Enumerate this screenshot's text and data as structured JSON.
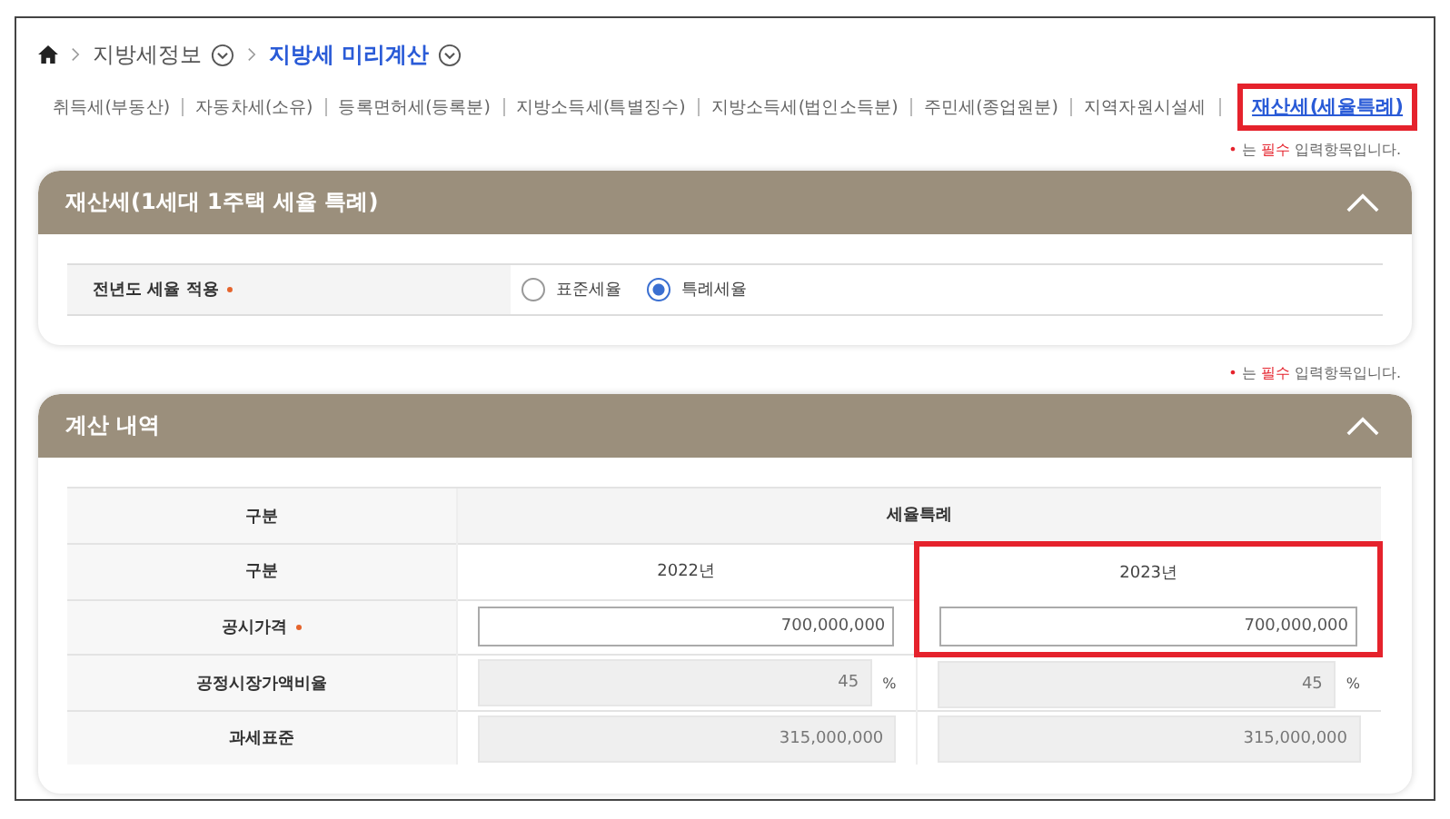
{
  "breadcrumb": [
    {
      "label": "지방세정보",
      "current": false
    },
    {
      "label": "지방세 미리계산",
      "current": true
    }
  ],
  "tabs": [
    {
      "label": "취득세(부동산)",
      "selected": false,
      "highlighted": false
    },
    {
      "label": "자동차세(소유)",
      "selected": false,
      "highlighted": false
    },
    {
      "label": "등록면허세(등록분)",
      "selected": false,
      "highlighted": false
    },
    {
      "label": "지방소득세(특별징수)",
      "selected": false,
      "highlighted": false
    },
    {
      "label": "지방소득세(법인소득분)",
      "selected": false,
      "highlighted": false
    },
    {
      "label": "주민세(종업원분)",
      "selected": false,
      "highlighted": false
    },
    {
      "label": "지역자원시설세",
      "selected": false,
      "highlighted": false
    },
    {
      "label": "재산세(세율특례)",
      "selected": true,
      "highlighted": true
    }
  ],
  "panels": [
    {
      "note": {
        "mark": "•",
        "before": "는",
        "keyword": "필수",
        "after": "입력항목입니다."
      },
      "kind": "form",
      "title": "재산세(1세대 1주택 세율 특례)",
      "expanded": true,
      "field": {
        "label": "전년도 세율 적용",
        "required": true,
        "options": [
          {
            "label": "표준세율",
            "selected": false
          },
          {
            "label": "특례세율",
            "selected": true
          }
        ]
      }
    },
    {
      "note": {
        "mark": "•",
        "before": "는",
        "keyword": "필수",
        "after": "입력항목입니다."
      },
      "kind": "table",
      "title": "계산 내역",
      "expanded": true,
      "table": {
        "header": [
          "구분",
          "세율특례"
        ],
        "columns_label": "구분",
        "columns": [
          {
            "label": "2022년",
            "highlighted": false
          },
          {
            "label": "2023년",
            "highlighted": true
          }
        ],
        "rows": [
          {
            "kind": "input",
            "label": "공시가격",
            "required": true,
            "values": [
              "700,000,000",
              "700,000,000"
            ]
          },
          {
            "kind": "readonly",
            "label": "공정시장가액비율",
            "required": false,
            "values": [
              "45",
              "45"
            ],
            "unit": "%"
          },
          {
            "kind": "readonly",
            "label": "과세표준",
            "required": false,
            "values": [
              "315,000,000",
              "315,000,000"
            ]
          }
        ]
      }
    }
  ]
}
